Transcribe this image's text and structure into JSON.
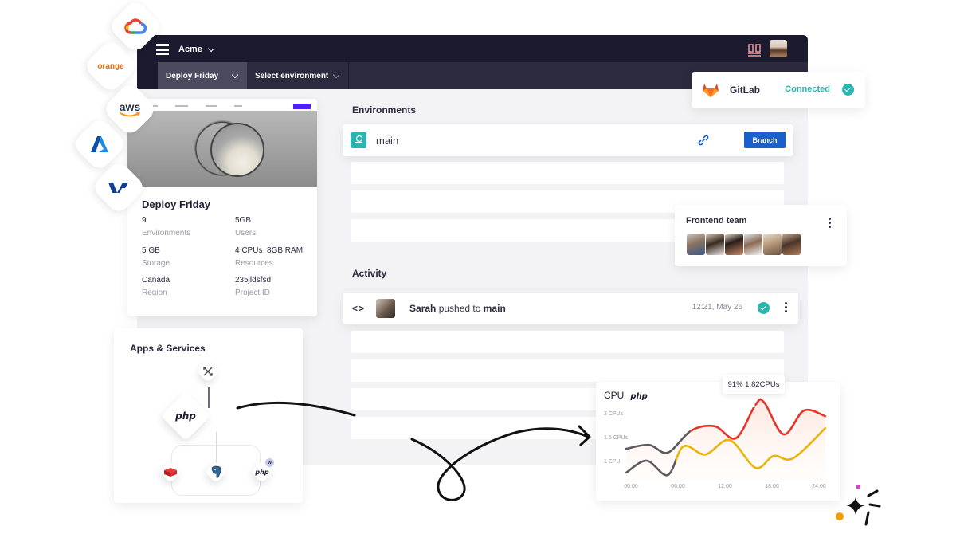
{
  "topbar": {
    "org_name": "Acme",
    "project_selector": "Deploy Friday",
    "environment_selector": "Select environment"
  },
  "cloud_providers": [
    {
      "name": "google-cloud"
    },
    {
      "name": "orange",
      "label": "orange"
    },
    {
      "name": "aws",
      "label": "aws"
    },
    {
      "name": "azure"
    },
    {
      "name": "ovh"
    }
  ],
  "project_card": {
    "title": "Deploy Friday",
    "stats": [
      {
        "value": "9",
        "label": "Environments"
      },
      {
        "value": "5GB",
        "label": "Users"
      },
      {
        "value": "5 GB",
        "label": "Storage"
      },
      {
        "value": "4 CPUs  8GB RAM",
        "label": "Resources"
      },
      {
        "value": "Canada",
        "label": "Region"
      },
      {
        "value": "235jldsfsd",
        "label": "Project ID"
      }
    ]
  },
  "environments": {
    "title": "Environments",
    "items": [
      {
        "name": "main",
        "button_label": "Branch"
      }
    ]
  },
  "activity": {
    "title": "Activity",
    "items": [
      {
        "user": "Sarah",
        "action": " pushed to ",
        "target": "main",
        "time": "12:21, May 26",
        "status": "success"
      }
    ]
  },
  "gitlab": {
    "label": "GitLab",
    "status": "Connected"
  },
  "team": {
    "title": "Frontend team",
    "member_count": 6
  },
  "apps_services": {
    "title": "Apps & Services",
    "nodes": [
      "router",
      "php",
      "redis",
      "postgresql",
      "php-worker"
    ],
    "php_label": "php",
    "worker_badge": "w"
  },
  "chart_data": {
    "type": "line",
    "title": "CPU",
    "subtitle": "php",
    "xlabel": "",
    "ylabel": "",
    "x_ticks": [
      "00:00",
      "06:00",
      "12:00",
      "18:00",
      "24:00"
    ],
    "y_ticks": [
      {
        "value": 1,
        "label": "1 CPU"
      },
      {
        "value": 1.5,
        "label": "1.5 CPUs"
      },
      {
        "value": 2,
        "label": "2 CPUs"
      }
    ],
    "xlim": [
      0,
      24
    ],
    "ylim": [
      0.6,
      2.3
    ],
    "grid": false,
    "tooltip": "91% 1.82CPUs",
    "series": [
      {
        "name": "upper",
        "color": "#e8332a",
        "history_color": "#5c5a5e",
        "history_until": 7.6,
        "x": [
          -0.6,
          2.3,
          4.7,
          7.7,
          10.7,
          13.4,
          15.9,
          17.0,
          19.5,
          22.1,
          24.8
        ],
        "values": [
          1.25,
          1.33,
          1.17,
          1.63,
          1.72,
          1.47,
          2.17,
          2.22,
          1.55,
          2.05,
          1.93
        ]
      },
      {
        "name": "lower",
        "color": "#eab308",
        "history_color": "#5c5a5e",
        "history_until": 5.7,
        "x": [
          -0.6,
          2.0,
          4.7,
          6.7,
          9.5,
          12.6,
          15.9,
          18.2,
          20.7,
          24.8
        ],
        "values": [
          0.75,
          1.0,
          0.7,
          1.3,
          1.13,
          1.43,
          0.85,
          1.1,
          1.05,
          1.68
        ]
      }
    ]
  },
  "colors": {
    "topbar_bg": "#1b1a2e",
    "accent_teal": "#2bb5b0",
    "primary_button": "#1a5fcc",
    "signup_button": "#4d1ff0"
  }
}
